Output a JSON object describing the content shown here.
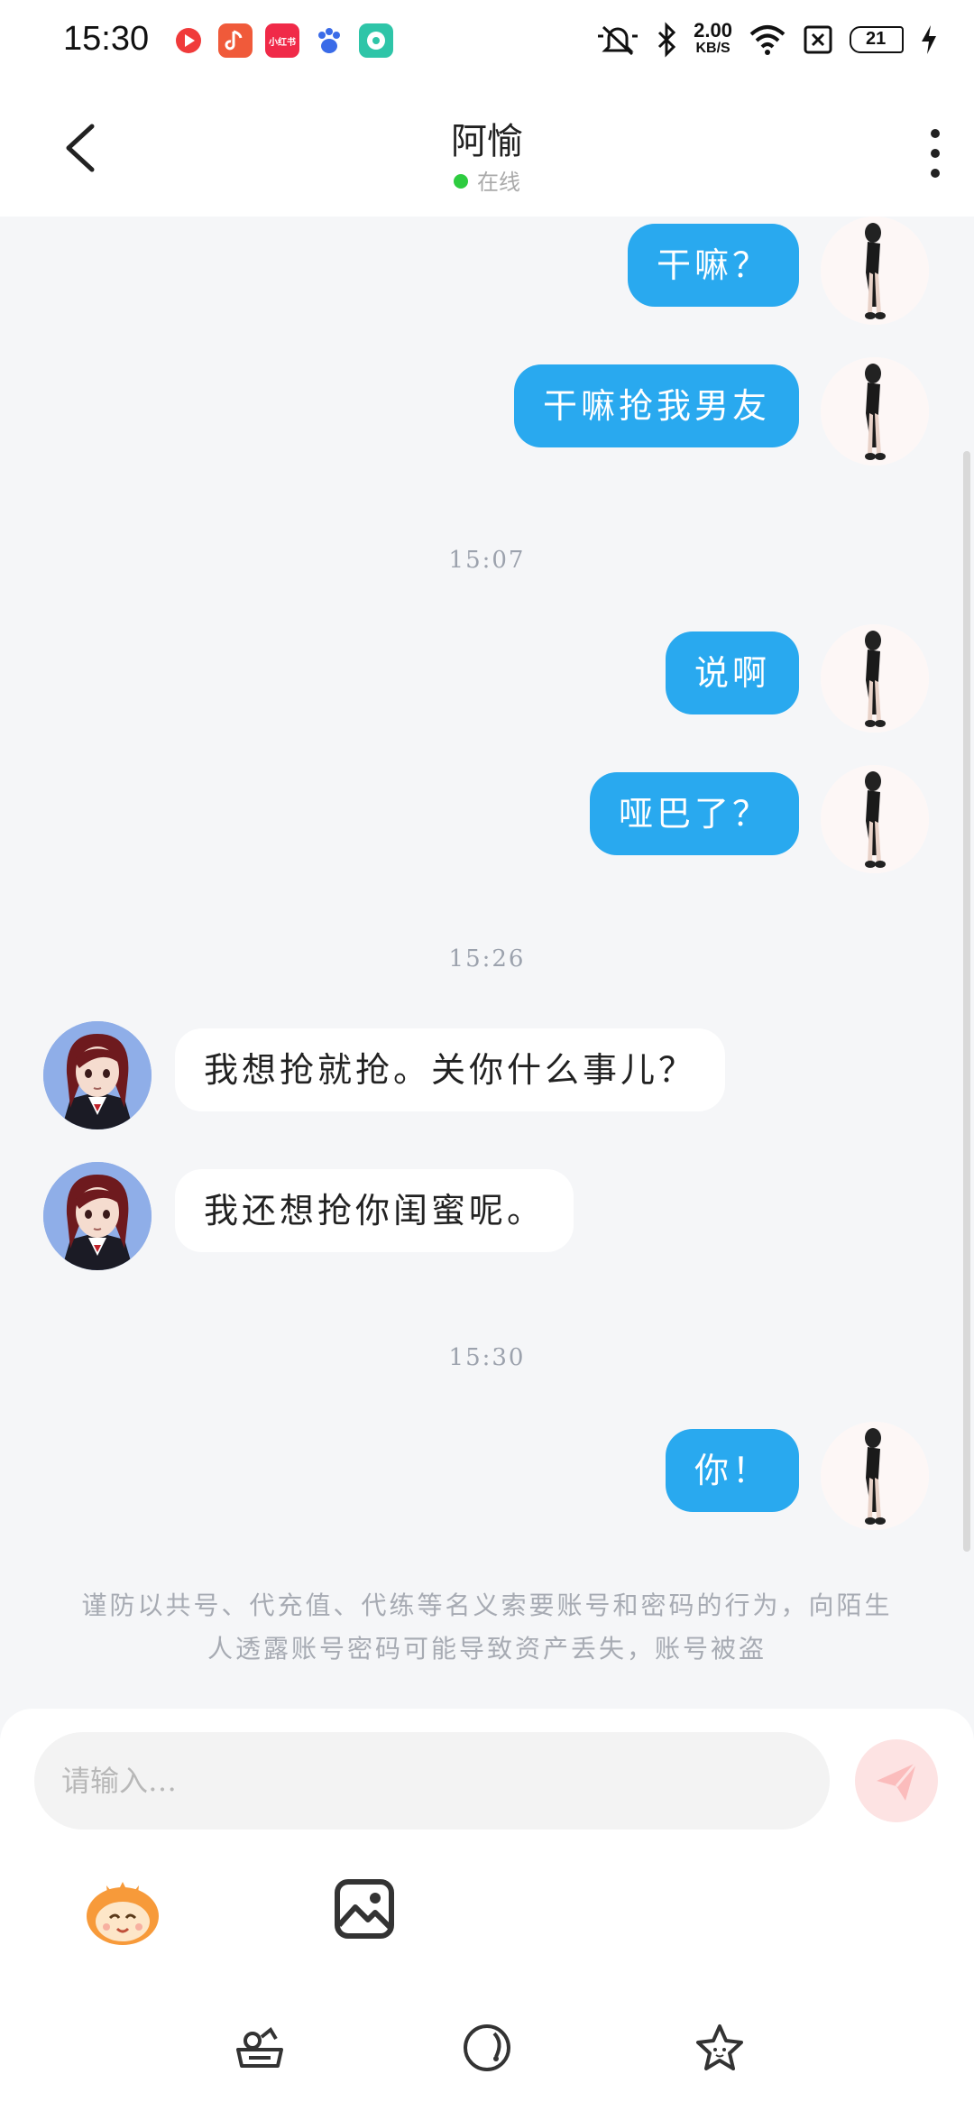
{
  "status_bar": {
    "time": "15:30",
    "net_speed_value": "2.00",
    "net_speed_unit": "KB/S",
    "battery": "21",
    "app_icons": [
      "video-app-icon",
      "music-app-icon",
      "xiaohongshu-icon",
      "baidu-icon",
      "chat-app-icon"
    ],
    "xiaohongshu_label": "小红书"
  },
  "header": {
    "title": "阿愉",
    "status": "在线",
    "status_color": "#2ecc40"
  },
  "colors": {
    "outgoing_bubble": "#29a9ef",
    "incoming_bubble": "#ffffff",
    "background": "#f5f6f8"
  },
  "messages": [
    {
      "type": "out",
      "text": "干嘛？"
    },
    {
      "type": "out",
      "text": "干嘛抢我男友"
    },
    {
      "type": "time",
      "text": "15:07"
    },
    {
      "type": "out",
      "text": "说啊"
    },
    {
      "type": "out",
      "text": "哑巴了？"
    },
    {
      "type": "time",
      "text": "15:26"
    },
    {
      "type": "in",
      "text": "我想抢就抢。关你什么事儿？"
    },
    {
      "type": "in",
      "text": "我还想抢你闺蜜呢。"
    },
    {
      "type": "time",
      "text": "15:30"
    },
    {
      "type": "out",
      "text": "你！"
    }
  ],
  "notice": "谨防以共号、代充值、代练等名义索要账号和密码的行为，向陌生人透露账号密码可能导致资产丢失，账号被盗",
  "input": {
    "placeholder": "请输入…"
  },
  "tools": [
    "emoji-sticker-icon",
    "image-icon"
  ],
  "bottom_icons": [
    "keyboard-skin-icon",
    "clock-icon",
    "star-icon"
  ]
}
